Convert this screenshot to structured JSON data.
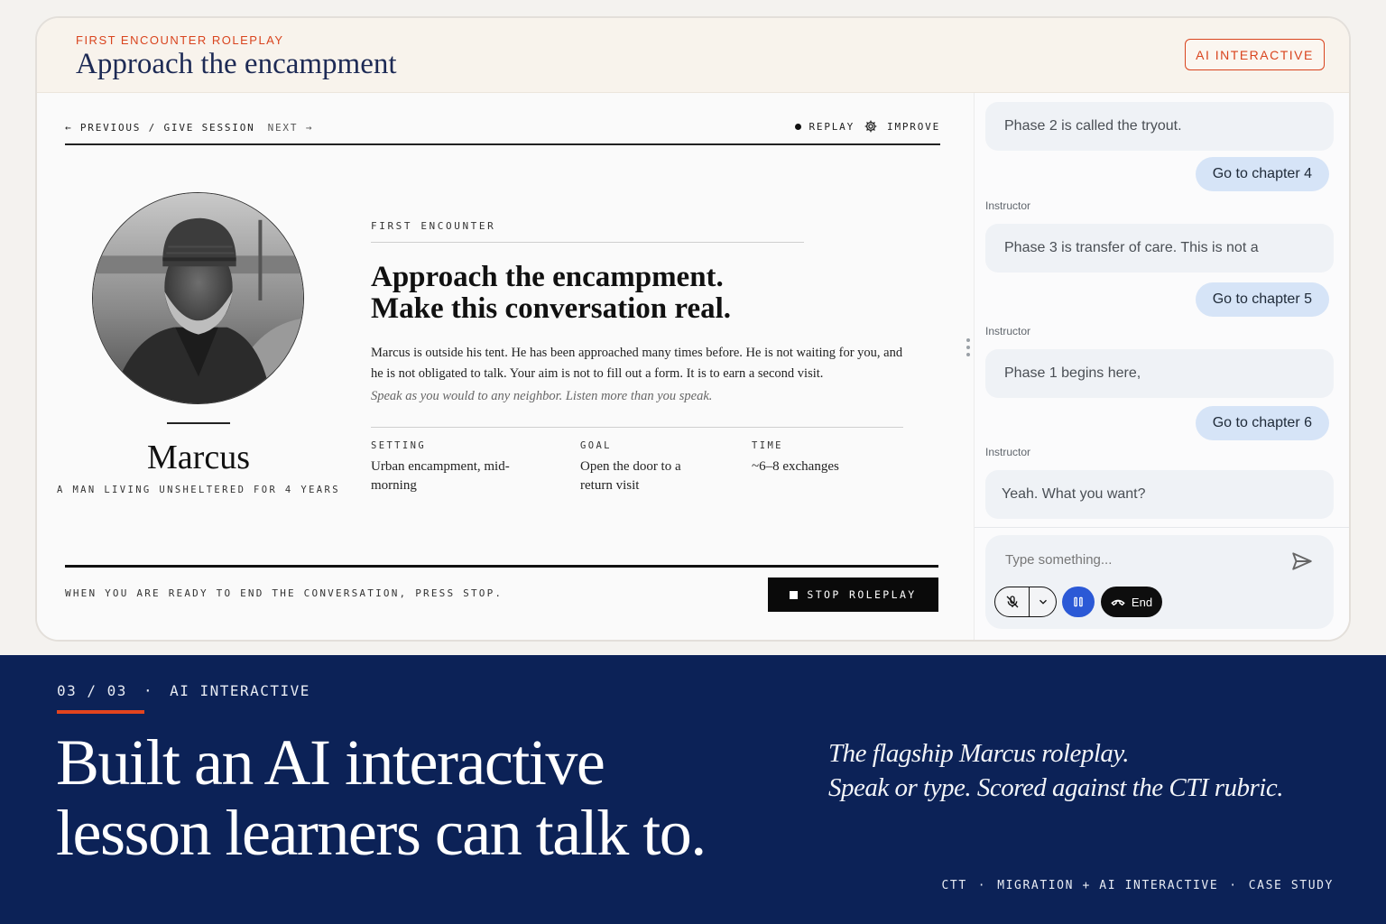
{
  "app": {
    "eyebrow": "FIRST ENCOUNTER ROLEPLAY",
    "title": "Approach the encampment",
    "badge": "AI INTERACTIVE"
  },
  "nav": {
    "previous": "← PREVIOUS / GIVE SESSION",
    "next": "NEXT →",
    "replay": "REPLAY",
    "improve": "IMPROVE"
  },
  "character": {
    "name": "Marcus",
    "subtitle": "A MAN LIVING UNSHELTERED FOR 4 YEARS"
  },
  "lesson": {
    "label": "FIRST ENCOUNTER",
    "heading_line1": "Approach the encampment.",
    "heading_line2": "Make this conversation real.",
    "body": "Marcus is outside his tent. He has been approached many times before. He is not waiting for you, and he is not obligated to talk. Your aim is not to fill out a form. It is to earn a second visit.",
    "hint": "Speak as you would to any neighbor. Listen more than you speak.",
    "meta": [
      {
        "key": "SETTING",
        "value": "Urban encampment, mid-morning"
      },
      {
        "key": "GOAL",
        "value": "Open the door to a return visit"
      },
      {
        "key": "TIME",
        "value": "~6–8 exchanges"
      }
    ],
    "end_note": "WHEN YOU ARE READY TO END THE CONVERSATION, PRESS STOP.",
    "stop_label": "STOP ROLEPLAY"
  },
  "chat": {
    "role_label": "Instructor",
    "messages": [
      {
        "from": "instructor",
        "text": "Phase 2 is called the tryout."
      },
      {
        "from": "user",
        "text": "Go to chapter 4"
      },
      {
        "from": "instructor",
        "text": "Phase 3 is transfer of care. This is not a"
      },
      {
        "from": "user",
        "text": "Go to chapter 5"
      },
      {
        "from": "instructor",
        "text": "Phase 1 begins here,"
      },
      {
        "from": "user",
        "text": "Go to chapter 6"
      },
      {
        "from": "instructor",
        "text": "Yeah. What you want?"
      }
    ],
    "input_placeholder": "Type something...",
    "end_label": "End"
  },
  "footer": {
    "counter": "03 / 03",
    "separator": "·",
    "section": "AI INTERACTIVE",
    "headline_line1": "Built an AI interactive",
    "headline_line2": "lesson learners can talk to.",
    "tagline_line1": "The flagship Marcus roleplay.",
    "tagline_line2": "Speak or type. Scored against the CTI rubric.",
    "meta": [
      "CTT",
      "·",
      "MIGRATION + AI INTERACTIVE",
      "·",
      "CASE STUDY"
    ]
  },
  "colors": {
    "accent": "#d9441e",
    "navy": "#0c2257",
    "title": "#1d2a55",
    "chip": "#d6e4f7",
    "pause": "#2b59d6"
  },
  "icons": [
    "dot-icon",
    "gear-icon",
    "stop-icon",
    "send-icon",
    "mic-off-icon",
    "chevron-down-icon",
    "pause-icon",
    "phone-end-icon"
  ]
}
